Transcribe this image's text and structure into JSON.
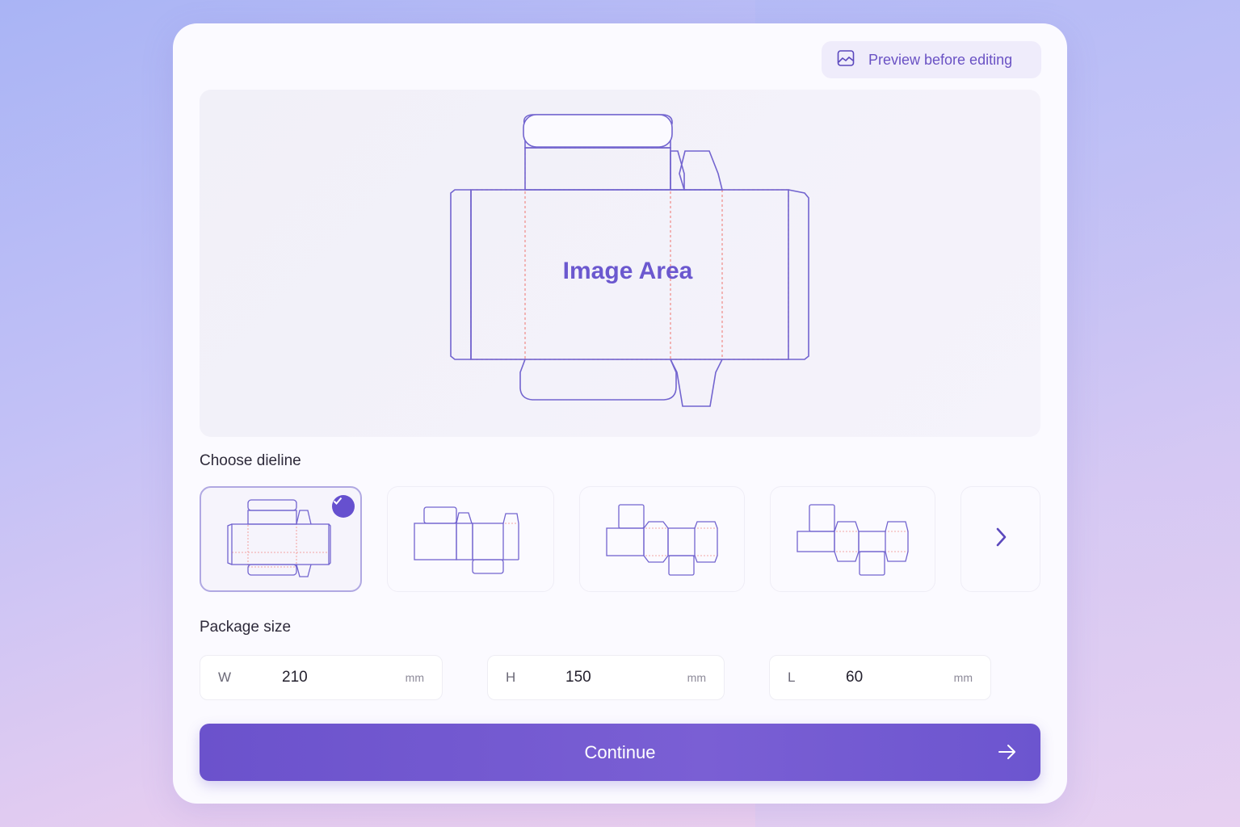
{
  "preview_button": {
    "label": "Preview before editing",
    "icon": "image-icon"
  },
  "image_area": {
    "label": "Image Area"
  },
  "dieline_section": {
    "title": "Choose dieline",
    "options": [
      {
        "name": "dieline-option-1",
        "selected": true
      },
      {
        "name": "dieline-option-2",
        "selected": false
      },
      {
        "name": "dieline-option-3",
        "selected": false
      },
      {
        "name": "dieline-option-4",
        "selected": false
      }
    ],
    "next_icon": "chevron-right-icon"
  },
  "package_size": {
    "title": "Package size",
    "width": {
      "label": "W",
      "value": "210",
      "unit": "mm"
    },
    "height": {
      "label": "H",
      "value": "150",
      "unit": "mm"
    },
    "length": {
      "label": "L",
      "value": "60",
      "unit": "mm"
    }
  },
  "continue_button": {
    "label": "Continue",
    "icon": "arrow-right-icon"
  },
  "colors": {
    "accent": "#6b52cc",
    "outline": "#6e5fd0",
    "fold_line": "#f08a86"
  }
}
